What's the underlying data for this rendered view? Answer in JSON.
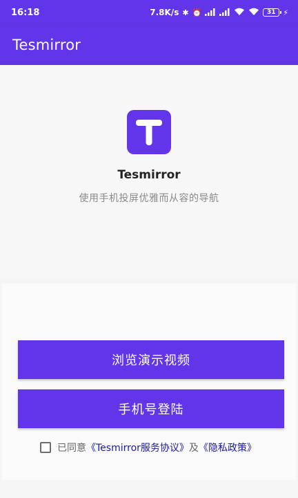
{
  "status_bar": {
    "time": "16:18",
    "net_speed": "7.8K/s",
    "battery": "31",
    "icons": [
      "bluetooth-icon",
      "alarm-icon",
      "signal-icon",
      "signal-icon",
      "wifi-icon",
      "wifi-icon",
      "battery-icon",
      "charging-icon"
    ]
  },
  "app_bar": {
    "title": "Tesmirror"
  },
  "hero": {
    "logo_letter": "T",
    "app_name": "Tesmirror",
    "tagline": "使用手机投屏优雅而从容的导航"
  },
  "actions": {
    "demo_label": "浏览演示视频",
    "login_label": "手机号登陆"
  },
  "agreement": {
    "prefix": "已同意",
    "terms_link": "《Tesmirror服务协议》",
    "and": "及",
    "privacy_link": "《隐私政策》",
    "checked": false
  },
  "colors": {
    "brand": "#6236e8",
    "link": "#1a1aa6"
  }
}
